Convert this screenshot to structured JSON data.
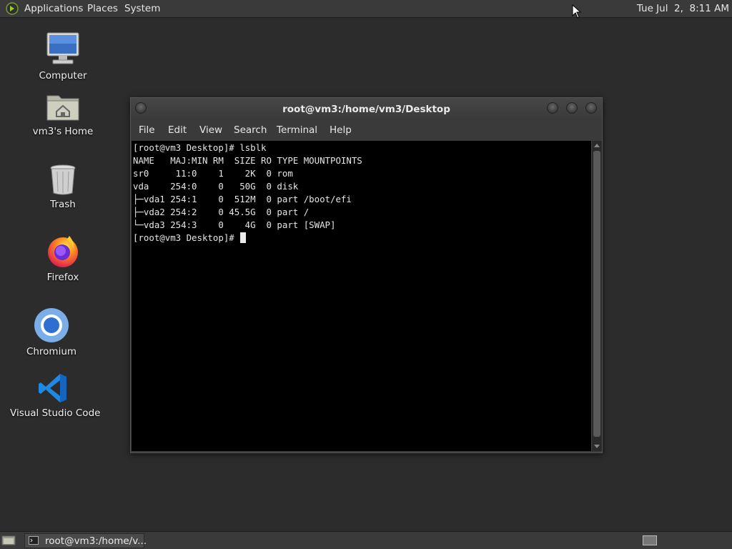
{
  "top_panel": {
    "menus": [
      "Applications",
      "Places",
      "System"
    ],
    "clock": "Tue Jul  2,  8:11 AM"
  },
  "desktop_icons": [
    {
      "label": "Computer",
      "icon": "computer-icon"
    },
    {
      "label": "vm3's Home",
      "icon": "home-folder-icon"
    },
    {
      "label": "Trash",
      "icon": "trash-icon"
    },
    {
      "label": "Firefox",
      "icon": "firefox-icon"
    },
    {
      "label": "Chromium",
      "icon": "chromium-icon"
    },
    {
      "label": "Visual Studio Code",
      "icon": "vscode-icon"
    }
  ],
  "terminal": {
    "title": "root@vm3:/home/vm3/Desktop",
    "menus": [
      "File",
      "Edit",
      "View",
      "Search",
      "Terminal",
      "Help"
    ],
    "lines": [
      "[root@vm3 Desktop]# lsblk",
      "NAME   MAJ:MIN RM  SIZE RO TYPE MOUNTPOINTS",
      "sr0     11:0    1    2K  0 rom",
      "vda    254:0    0   50G  0 disk",
      "├─vda1 254:1    0  512M  0 part /boot/efi",
      "├─vda2 254:2    0 45.5G  0 part /",
      "└─vda3 254:3    0    4G  0 part [SWAP]"
    ],
    "prompt": "[root@vm3 Desktop]# "
  },
  "taskbar": {
    "task_label": "root@vm3:/home/v..."
  },
  "colors": {
    "desktop_bg": "#2c2c2c",
    "panel_bg": "#3a3a3a",
    "terminal_bg": "#000000",
    "terminal_fg": "#e5e5e5"
  }
}
